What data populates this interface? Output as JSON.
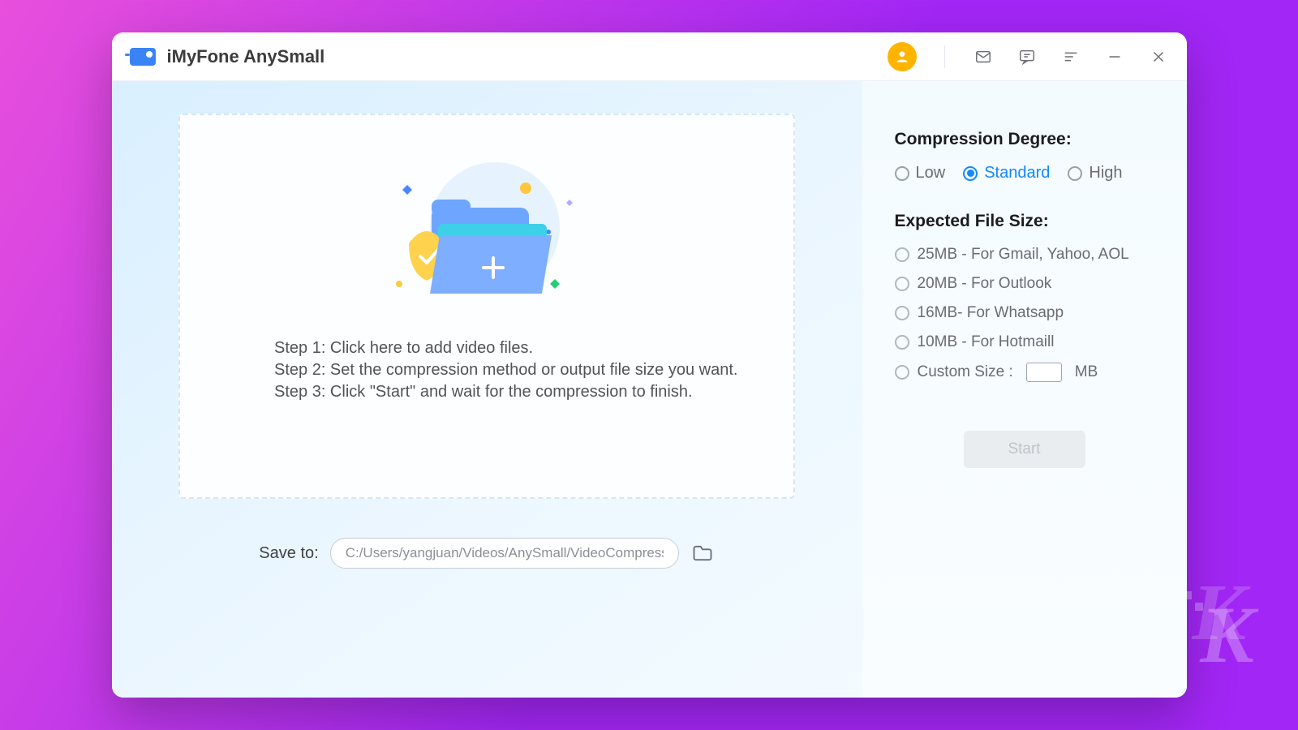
{
  "app": {
    "title": "iMyFone AnySmall"
  },
  "dropzone": {
    "step1": "Step 1: Click here to add video files.",
    "step2": "Step 2: Set the compression method or output file size you want.",
    "step3": "Step 3: Click \"Start\" and wait for the compression to finish."
  },
  "save": {
    "label": "Save to:",
    "path": "C:/Users/yangjuan/Videos/AnySmall/VideoCompressor/"
  },
  "compression": {
    "heading": "Compression Degree:",
    "options": {
      "low": "Low",
      "standard": "Standard",
      "high": "High"
    },
    "selected": "standard"
  },
  "filesize": {
    "heading": "Expected File Size:",
    "options": [
      "25MB - For Gmail, Yahoo, AOL",
      "20MB - For Outlook",
      "16MB- For Whatsapp",
      "10MB - For Hotmaill"
    ],
    "custom_label_prefix": "Custom Size :",
    "custom_label_suffix": "MB",
    "custom_value": ""
  },
  "start_label": "Start",
  "watermark": "K"
}
